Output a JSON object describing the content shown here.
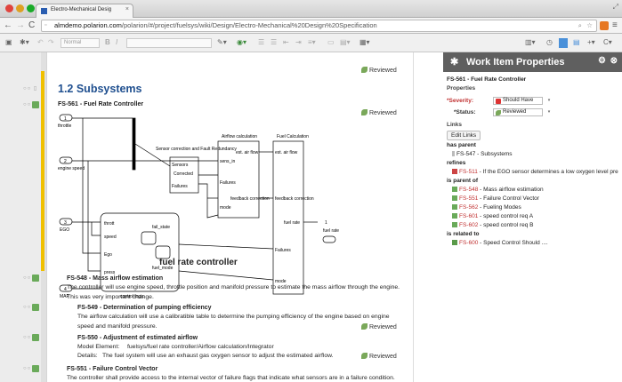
{
  "browser": {
    "tab_title": "Electro-Mechanical Desig",
    "url_host": "almdemo.polarion.com",
    "url_path": "/polarion/#/project/fuelsys/wiki/Design/Electro-Mechanical%20Design%20Specification"
  },
  "toolbar": {
    "style_value": "Normal",
    "bold": "B",
    "italic": "I"
  },
  "doc": {
    "reviewed": "Reviewed",
    "section_title": "1.2 Subsystems",
    "fs561": "FS-561 - Fuel Rate Controller",
    "diagram": {
      "caption": "fuel rate controller",
      "in1": "1",
      "in1_label": "throttle",
      "in2": "2",
      "in2_label": "engine speed",
      "in3": "3",
      "in3_label": "EGO",
      "in4": "4",
      "in4_label": "MAP",
      "out1": "1",
      "out1_label": "fuel rate",
      "sensor_block_title": "Sensor correction and Fault Redundancy",
      "sensor_ports": [
        "Sensors",
        "Corrected",
        "Failures"
      ],
      "airflow_title": "Airflow calculation",
      "airflow_ports": [
        "sens_in",
        "est. air flow",
        "Failures",
        "mode",
        "feedback correction"
      ],
      "fuelcalc_title": "Fuel Calculation",
      "fuelcalc_ports": [
        "est. air flow",
        "feedback correction",
        "fuel rate",
        "Failures",
        "mode"
      ],
      "control_title": "control logic",
      "control_ports": [
        "thrott",
        "speed",
        "Ego",
        "press",
        "fail_state",
        "fuel_mode"
      ]
    },
    "fs548_title": "FS-548 - Mass airflow estimation",
    "fs548_text": "The controller will use engine speed, throttle position and manifold pressure to estimate the mass airflow through the engine.",
    "fs548_text2": "This was very important change.",
    "fs549_title": "FS-549 - Determination of pumping efficiency",
    "fs549_text": "The airflow calculation will use a calibratible table to determine the pumping efficiency of the engine based on engine",
    "fs549_text2": "speed and manifold pressure.",
    "fs550_title": "FS-550 - Adjustment of estimated airflow",
    "fs550_model_label": "Model Element:",
    "fs550_model_value": "fuelsys/fuel rate controller/Airflow calculation/Integrator",
    "fs550_details_label": "Details:",
    "fs550_details_value": "The fuel system will use an exhaust gas oxygen sensor to adjust the estimated airflow.",
    "fs551_title": "FS-551 - Failure Control Vector",
    "fs551_text": "The controller shall provide access to the internal vector of failure flags that indicate what sensors are in a failure condition."
  },
  "panel": {
    "title": "Work Item Properties",
    "item": "FS-561 - Fuel Rate Controller",
    "properties": "Properties",
    "severity_label": "*Severity:",
    "severity_value": "Should Have",
    "status_label": "*Status:",
    "status_value": "Reviewed",
    "links": "Links",
    "edit_links": "Edit Links",
    "has_parent": "has parent",
    "parent_item": "FS-547 - Subsystems",
    "refines": "refines",
    "refines_item_id": "FS-511",
    "refines_item_text": " - If the EGO sensor determines a low oxygen level pre",
    "is_parent_of": "is parent of",
    "children": [
      {
        "id": "FS-548",
        "text": " - Mass airflow estimation"
      },
      {
        "id": "FS-551",
        "text": " - Failure Control Vector"
      },
      {
        "id": "FS-562",
        "text": " - Fueling Modes"
      },
      {
        "id": "FS-601",
        "text": " - speed control req A"
      },
      {
        "id": "FS-602",
        "text": " - speed control req B"
      }
    ],
    "is_related_to": "is related to",
    "related_item_id": "FS-600",
    "related_item_text": " - Speed Control Should ....",
    "colors": {
      "header": "#5f5f5f",
      "accent": "#f0c000",
      "link_red": "#c03030"
    }
  }
}
